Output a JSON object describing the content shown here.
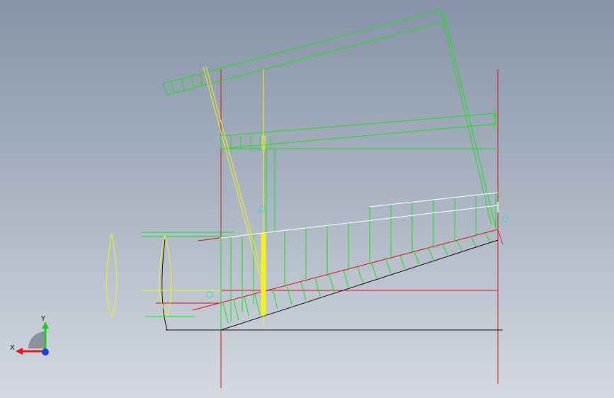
{
  "viewport": {
    "background_top": "#8793a7",
    "background_bottom": "#d4d9e0"
  },
  "triad": {
    "x_label": "X",
    "y_label": "Y",
    "x_color": "#e01b1b",
    "y_color": "#22c922",
    "z_color": "#1f3fd6"
  },
  "colors": {
    "green": "#18e018",
    "red": "#e01010",
    "yellow": "#f2f21a",
    "white": "#ffffff",
    "black": "#101010",
    "cyan": "#27d6d6"
  }
}
